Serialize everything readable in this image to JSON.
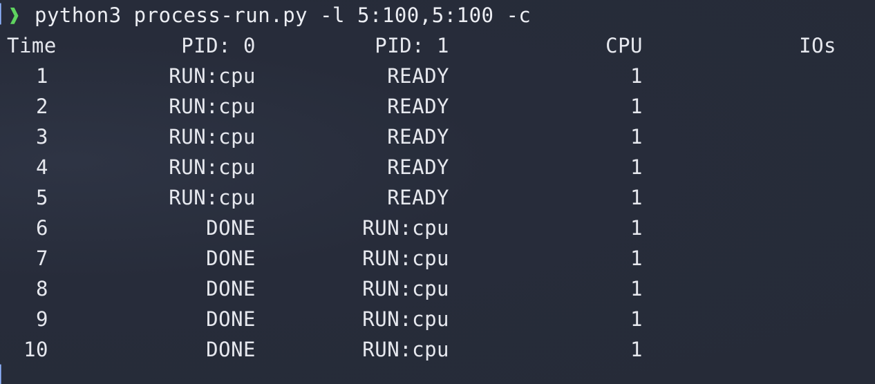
{
  "prompt": {
    "chevron": "❱",
    "command": "python3 process-run.py -l 5:100,5:100 -c"
  },
  "table": {
    "headers": {
      "time": "Time",
      "pid0": "PID: 0",
      "pid1": "PID: 1",
      "cpu": "CPU",
      "ios": "IOs"
    },
    "rows": [
      {
        "time": "1",
        "pid0": "RUN:cpu",
        "pid1": "READY",
        "cpu": "1",
        "ios": ""
      },
      {
        "time": "2",
        "pid0": "RUN:cpu",
        "pid1": "READY",
        "cpu": "1",
        "ios": ""
      },
      {
        "time": "3",
        "pid0": "RUN:cpu",
        "pid1": "READY",
        "cpu": "1",
        "ios": ""
      },
      {
        "time": "4",
        "pid0": "RUN:cpu",
        "pid1": "READY",
        "cpu": "1",
        "ios": ""
      },
      {
        "time": "5",
        "pid0": "RUN:cpu",
        "pid1": "READY",
        "cpu": "1",
        "ios": ""
      },
      {
        "time": "6",
        "pid0": "DONE",
        "pid1": "RUN:cpu",
        "cpu": "1",
        "ios": ""
      },
      {
        "time": "7",
        "pid0": "DONE",
        "pid1": "RUN:cpu",
        "cpu": "1",
        "ios": ""
      },
      {
        "time": "8",
        "pid0": "DONE",
        "pid1": "RUN:cpu",
        "cpu": "1",
        "ios": ""
      },
      {
        "time": "9",
        "pid0": "DONE",
        "pid1": "RUN:cpu",
        "cpu": "1",
        "ios": ""
      },
      {
        "time": "10",
        "pid0": "DONE",
        "pid1": "RUN:cpu",
        "cpu": "1",
        "ios": ""
      }
    ]
  },
  "colors": {
    "background": "#272c3a",
    "text": "#e6e8ee",
    "prompt_arrow": "#5fd35f",
    "prompt_edge": "#8fb4ff"
  },
  "icons": {
    "prompt": "chevron-right-icon",
    "edge": "cursor-edge-icon"
  }
}
